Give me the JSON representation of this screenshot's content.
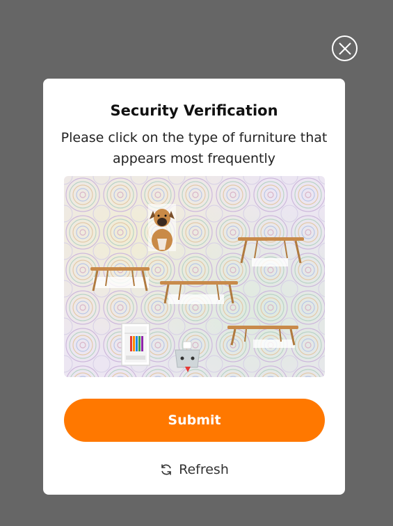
{
  "dialog": {
    "title": "Security Verification",
    "instruction": "Please click on the type of furniture that appears most frequently",
    "submit_label": "Submit",
    "refresh_label": "Refresh"
  },
  "puzzle_items": [
    {
      "kind": "dog",
      "name": "puzzle-dog-image"
    },
    {
      "kind": "table",
      "name": "puzzle-table-image"
    },
    {
      "kind": "table",
      "name": "puzzle-table-image"
    },
    {
      "kind": "table",
      "name": "puzzle-table-image"
    },
    {
      "kind": "table",
      "name": "puzzle-table-image"
    },
    {
      "kind": "shelf",
      "name": "puzzle-shelf-image"
    },
    {
      "kind": "bottle",
      "name": "puzzle-bottle-image"
    }
  ],
  "colors": {
    "overlay": "#666666",
    "accent": "#ff7800",
    "card": "#ffffff"
  },
  "icons": {
    "close": "close-icon",
    "refresh": "refresh-icon"
  }
}
